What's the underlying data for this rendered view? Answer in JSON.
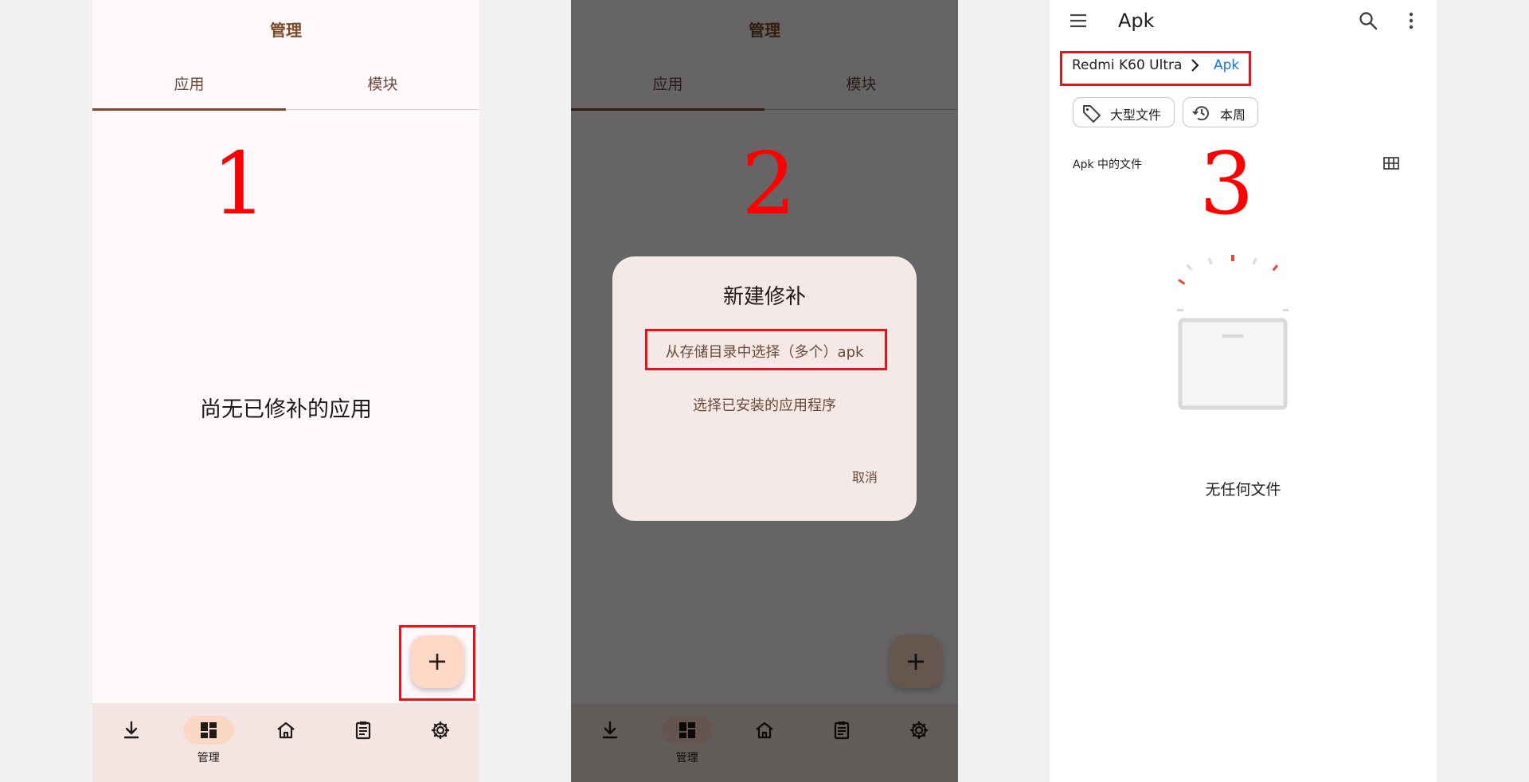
{
  "panel1": {
    "header_title": "管理",
    "tabs": [
      "应用",
      "模块"
    ],
    "step": "1",
    "empty_text": "尚无已修补的应用",
    "fab_label": "+",
    "nav": [
      "",
      "管理",
      "",
      "",
      ""
    ]
  },
  "panel2": {
    "header_title": "管理",
    "tabs": [
      "应用",
      "模块"
    ],
    "step": "2",
    "fab_label": "+",
    "nav": [
      "",
      "管理",
      "",
      "",
      ""
    ],
    "dialog": {
      "title": "新建修补",
      "options": [
        "从存储目录中选择（多个）apk",
        "选择已安装的应用程序"
      ],
      "cancel": "取消"
    }
  },
  "panel3": {
    "title": "Apk",
    "breadcrumb": [
      "Redmi K60 Ultra",
      "Apk"
    ],
    "chips": [
      "大型文件",
      "本周"
    ],
    "section_title": "Apk 中的文件",
    "step": "3",
    "empty_text": "无任何文件"
  },
  "colors": {
    "accent": "#7b4b27",
    "highlight": "#e8131a",
    "link": "#1a73e8",
    "fab": "#fdd8c4",
    "nav_bg": "#f4e5e2"
  },
  "icons": [
    "download-icon",
    "dashboard-icon",
    "home-icon",
    "clipboard-icon",
    "settings-icon",
    "menu-icon",
    "search-icon",
    "more-vert-icon",
    "chevron-right-icon",
    "tag-icon",
    "history-icon",
    "grid-view-icon"
  ]
}
